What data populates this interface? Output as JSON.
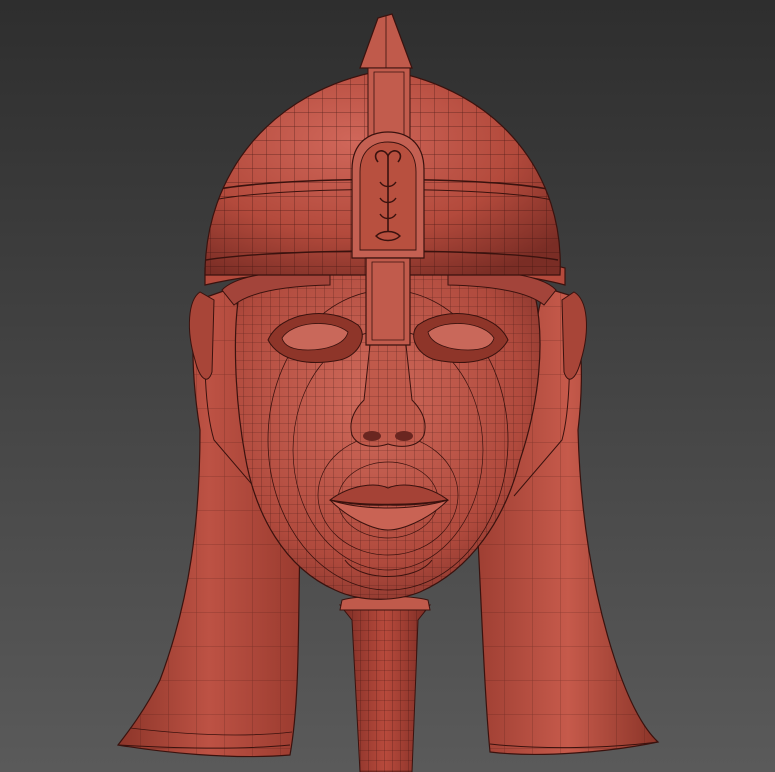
{
  "scene": {
    "subject": "",
    "viewport_background": {
      "top": "#2e2e2e",
      "bottom": "#5a5a5a"
    },
    "mesh_color": "#b84a3c",
    "mesh_shadow_color": "#6e2a22",
    "mesh_highlight_color": "#d97462",
    "wire_color": "#3a120e"
  }
}
